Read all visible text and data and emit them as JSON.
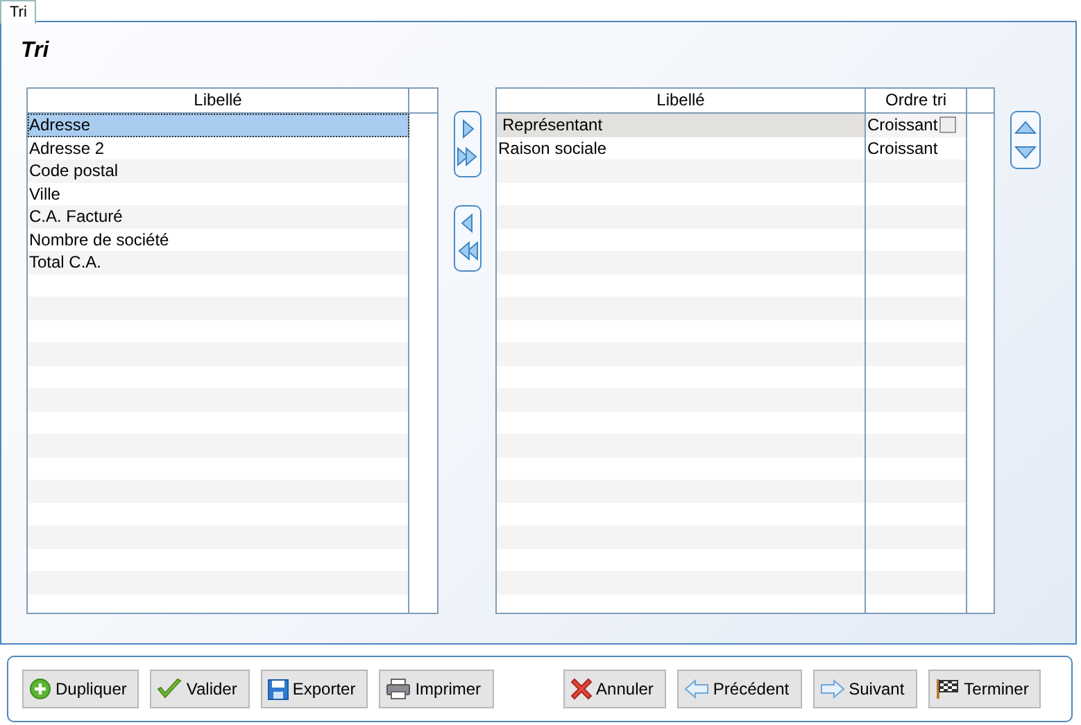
{
  "tab": {
    "label": "Tri",
    "selected": true
  },
  "title": "Tri",
  "available": {
    "columns": [
      "Libellé"
    ],
    "rows": [
      {
        "label": "Adresse",
        "selected": true
      },
      {
        "label": "Adresse 2",
        "selected": false
      },
      {
        "label": "Code postal",
        "selected": false
      },
      {
        "label": "Ville",
        "selected": false
      },
      {
        "label": "C.A. Facturé",
        "selected": false
      },
      {
        "label": "Nombre de société",
        "selected": false
      },
      {
        "label": "Total C.A.",
        "selected": false
      }
    ]
  },
  "sorted": {
    "columns": [
      "Libellé",
      "Ordre tri"
    ],
    "rows": [
      {
        "label": "Représentant",
        "order": "Croissant",
        "selected": true
      },
      {
        "label": "Raison sociale",
        "order": "Croissant",
        "selected": false
      }
    ]
  },
  "buttons": [
    {
      "label": "Dupliquer",
      "kind": "add"
    },
    {
      "label": "Valider",
      "kind": "check"
    },
    {
      "label": "Exporter",
      "kind": "save"
    },
    {
      "label": "Imprimer",
      "kind": "print"
    },
    {
      "label": "Annuler",
      "kind": "cancel"
    },
    {
      "label": "Précédent",
      "kind": "back"
    },
    {
      "label": "Suivant",
      "kind": "next"
    },
    {
      "label": "Terminer",
      "kind": "finish"
    }
  ]
}
